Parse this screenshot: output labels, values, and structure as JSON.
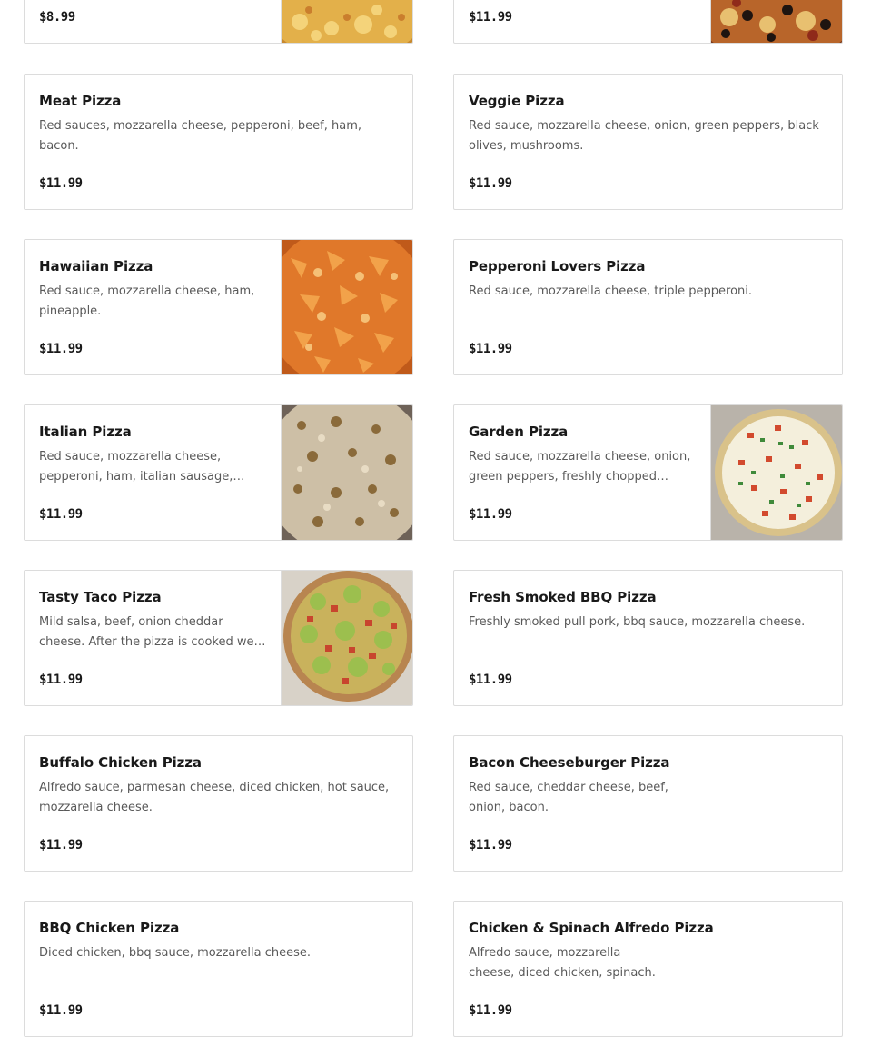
{
  "menu": {
    "items": [
      {
        "name": "",
        "description": "",
        "price": "$8.99",
        "image": "cheese-pizza-photo"
      },
      {
        "name": "",
        "description": "",
        "price": "$11.99",
        "image": "supreme-pizza-photo"
      },
      {
        "name": "Meat Pizza",
        "description": "Red sauces, mozzarella cheese, pepperoni, beef, ham, bacon.",
        "price": "$11.99"
      },
      {
        "name": "Veggie Pizza",
        "description": "Red sauce, mozzarella cheese, onion, green peppers, black olives, mushrooms.",
        "price": "$11.99"
      },
      {
        "name": "Hawaiian Pizza",
        "description": "Red sauce, mozzarella cheese, ham, pineapple.",
        "price": "$11.99",
        "image": "hawaiian-pizza-photo"
      },
      {
        "name": "Pepperoni Lovers Pizza",
        "description": "Red sauce, mozzarella cheese, triple pepperoni.",
        "price": "$11.99"
      },
      {
        "name": "Italian Pizza",
        "description": "Red sauce, mozzarella cheese, pepperoni, ham, italian sausage, italian seasoning.",
        "price": "$11.99",
        "image": "italian-pizza-photo"
      },
      {
        "name": "Garden Pizza",
        "description": "Red sauce, mozzarella cheese, onion, green peppers, freshly chopped tomatoes.",
        "price": "$11.99",
        "image": "garden-pizza-photo"
      },
      {
        "name": "Tasty Taco Pizza",
        "description": "Mild salsa, beef, onion cheddar cheese. After the pizza is cooked we add fresh lettuce and tomatoes.",
        "price": "$11.99",
        "image": "taco-pizza-photo"
      },
      {
        "name": "Fresh Smoked BBQ Pizza",
        "description": "Freshly smoked pull pork, bbq sauce, mozzarella cheese.",
        "price": "$11.99"
      },
      {
        "name": "Buffalo Chicken Pizza",
        "description": "Alfredo sauce, parmesan cheese, diced chicken, hot sauce, mozzarella cheese.",
        "price": "$11.99"
      },
      {
        "name": "Bacon Cheeseburger Pizza",
        "description": "Red sauce, cheddar cheese, beef, onion, bacon.",
        "price": "$11.99"
      },
      {
        "name": "BBQ Chicken Pizza",
        "description": "Diced chicken, bbq sauce, mozzarella cheese.",
        "price": "$11.99"
      },
      {
        "name": "Chicken & Spinach Alfredo Pizza",
        "description": "Alfredo sauce, mozzarella cheese, diced chicken, spinach.",
        "price": "$11.99"
      }
    ]
  }
}
